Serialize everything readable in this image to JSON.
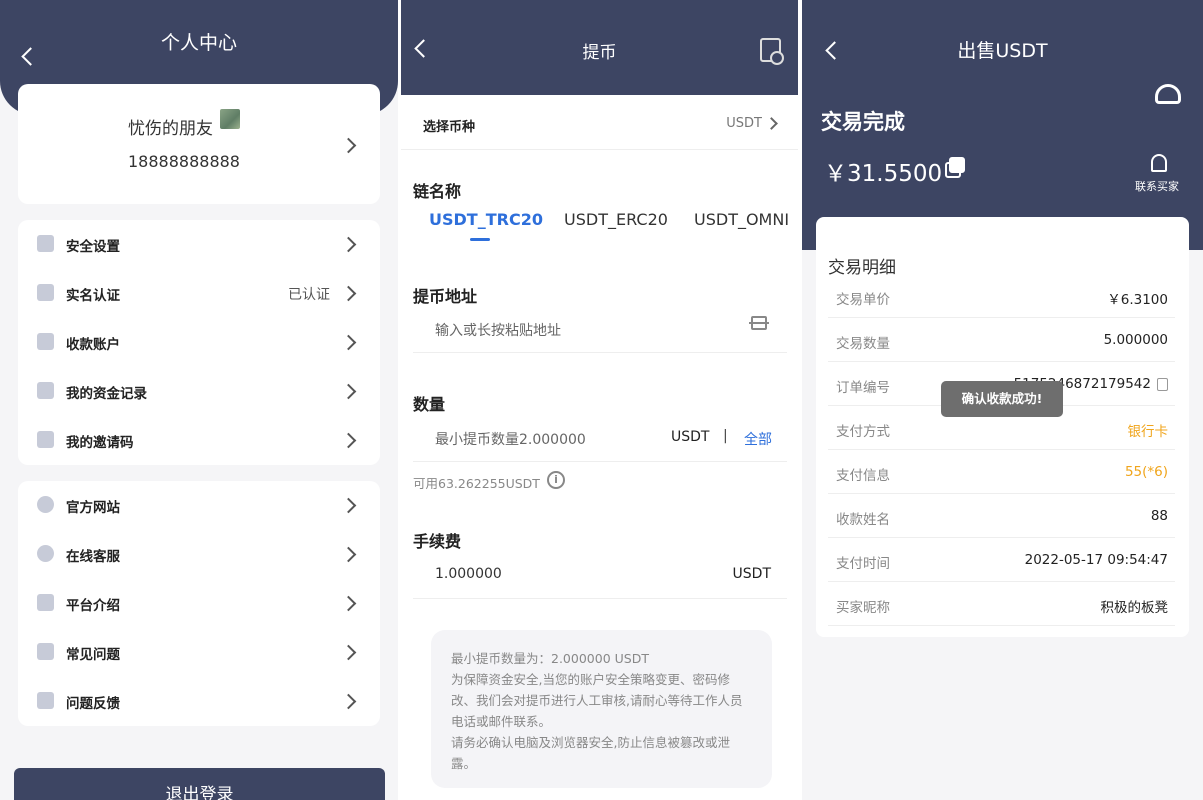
{
  "profile_page": {
    "title": "个人中心",
    "user_name": "忧伤的朋友",
    "phone": "18888888888",
    "menu_group1": [
      {
        "label": "安全设置",
        "value": "",
        "icon": "shield-icon"
      },
      {
        "label": "实名认证",
        "value": "已认证",
        "icon": "wallet-icon"
      },
      {
        "label": "收款账户",
        "value": "",
        "icon": "account-icon"
      },
      {
        "label": "我的资金记录",
        "value": "",
        "icon": "fund-record-icon"
      },
      {
        "label": "我的邀请码",
        "value": "",
        "icon": "invite-icon"
      }
    ],
    "menu_group2": [
      {
        "label": "官方网站",
        "icon": "website-icon"
      },
      {
        "label": "在线客服",
        "icon": "headset-icon"
      },
      {
        "label": "平台介绍",
        "icon": "document-icon"
      },
      {
        "label": "常见问题",
        "icon": "faq-icon"
      },
      {
        "label": "问题反馈",
        "icon": "feedback-icon"
      }
    ],
    "logout_label": "退出登录"
  },
  "withdraw_page": {
    "title": "提币",
    "select_coin_label": "选择币种",
    "select_coin_value": "USDT",
    "chain_name_label": "链名称",
    "chains": [
      "USDT_TRC20",
      "USDT_ERC20",
      "USDT_OMNI"
    ],
    "active_chain": "USDT_TRC20",
    "address_label": "提币地址",
    "address_placeholder": "输入或长按粘贴地址",
    "amount_label": "数量",
    "amount_placeholder": "最小提币数量2.000000",
    "amount_unit": "USDT",
    "amount_separator": "|",
    "amount_all": "全部",
    "available": "可用63.262255USDT",
    "fee_label": "手续费",
    "fee_value": "1.000000",
    "fee_unit": "USDT",
    "notice_lines": [
      "最小提币数量为：2.000000 USDT",
      "为保障资金安全,当您的账户安全策略变更、密码修改、我们会对提币进行人工审核,请耐心等待工作人员电话或邮件联系。",
      "请务必确认电脑及浏览器安全,防止信息被篡改或泄露。"
    ]
  },
  "sell_page": {
    "title": "出售USDT",
    "status": "交易完成",
    "amount": "￥31.5500",
    "contact_label": "联系买家",
    "detail_title": "交易明细",
    "rows": [
      {
        "key": "交易单价",
        "value": "￥6.3100"
      },
      {
        "key": "交易数量",
        "value": "5.000000"
      },
      {
        "key": "订单编号",
        "value": "5175246872179542"
      },
      {
        "key": "支付方式",
        "value": "银行卡"
      },
      {
        "key": "支付信息",
        "value": "55(*6)"
      },
      {
        "key": "收款姓名",
        "value": "88"
      },
      {
        "key": "支付时间",
        "value": "2022-05-17 09:54:47"
      },
      {
        "key": "买家昵称",
        "value": "积极的板凳"
      }
    ],
    "toast": "确认收款成功!",
    "accent_orange": "#f0a51c"
  },
  "colors": {
    "header_navy": "#3d4563",
    "link_blue": "#2e6fdb"
  }
}
